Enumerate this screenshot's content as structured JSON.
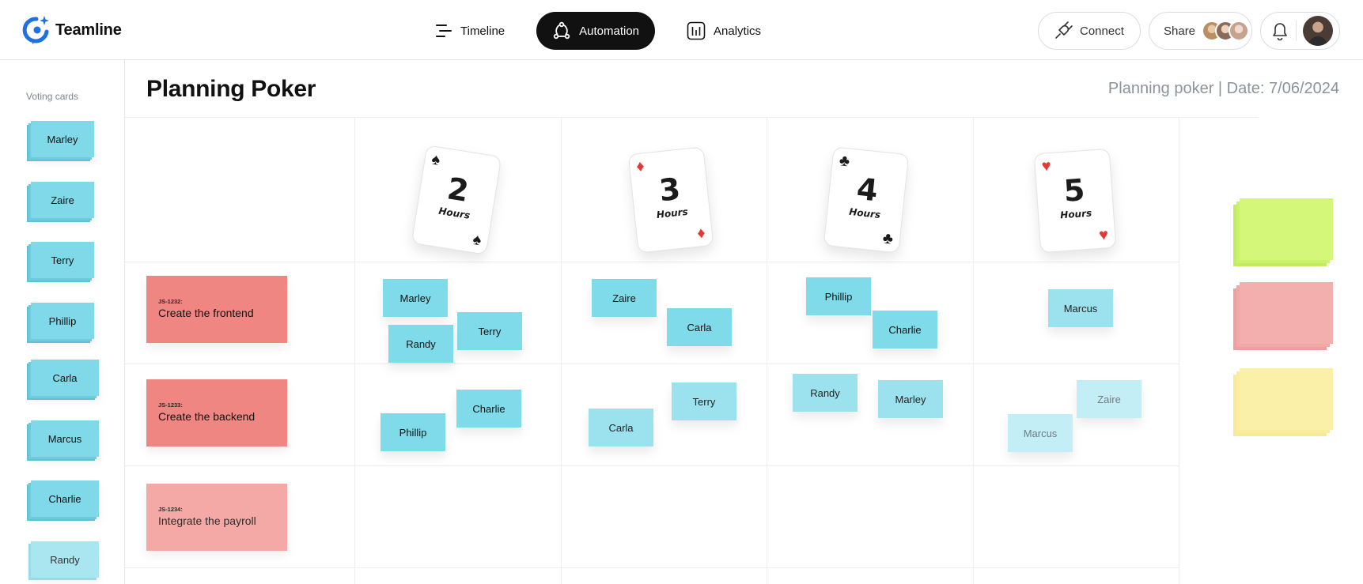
{
  "app": {
    "name": "Teamline"
  },
  "nav": [
    {
      "label": "Timeline",
      "icon": "timeline-icon",
      "active": false
    },
    {
      "label": "Automation",
      "icon": "automation-icon",
      "active": true
    },
    {
      "label": "Analytics",
      "icon": "analytics-icon",
      "active": false
    }
  ],
  "header_actions": {
    "connect_label": "Connect",
    "share_label": "Share"
  },
  "sidebar": {
    "title": "Voting cards",
    "cards": [
      "Marley",
      "Zaire",
      "Terry",
      "Phillip",
      "Carla",
      "Marcus",
      "Charlie",
      "Randy"
    ]
  },
  "page": {
    "title": "Planning Poker",
    "meta": "Planning poker | Date: 7/06/2024"
  },
  "estimates": [
    {
      "value": "2",
      "unit": "Hours",
      "suit": "♠",
      "color": "black"
    },
    {
      "value": "3",
      "unit": "Hours",
      "suit": "♦",
      "color": "red"
    },
    {
      "value": "4",
      "unit": "Hours",
      "suit": "♣",
      "color": "black"
    },
    {
      "value": "5",
      "unit": "Hours",
      "suit": "♥",
      "color": "red"
    }
  ],
  "tickets": [
    {
      "id": "JS-1232:",
      "title": "Create the frontend"
    },
    {
      "id": "JS-1233:",
      "title": "Create the backend"
    },
    {
      "id": "JS-1234:",
      "title": "Integrate the payroll"
    }
  ],
  "votes": {
    "row1": {
      "col2": [
        "Marley",
        "Terry",
        "Randy"
      ],
      "col3": [
        "Zaire",
        "Carla"
      ],
      "col4": [
        "Phillip",
        "Charlie"
      ],
      "col5": [
        "Marcus"
      ]
    },
    "row2": {
      "col2": [
        "Charlie",
        "Phillip"
      ],
      "col3": [
        "Terry",
        "Carla"
      ],
      "col4": [
        "Randy",
        "Marley"
      ],
      "col5": [
        "Zaire",
        "Marcus"
      ]
    }
  },
  "colors": {
    "note": "#7fdbe9",
    "ticket": "#ef8682",
    "stack_green": "#d4f779",
    "stack_red": "#f3aeae",
    "stack_yellow": "#fbf0a8"
  }
}
